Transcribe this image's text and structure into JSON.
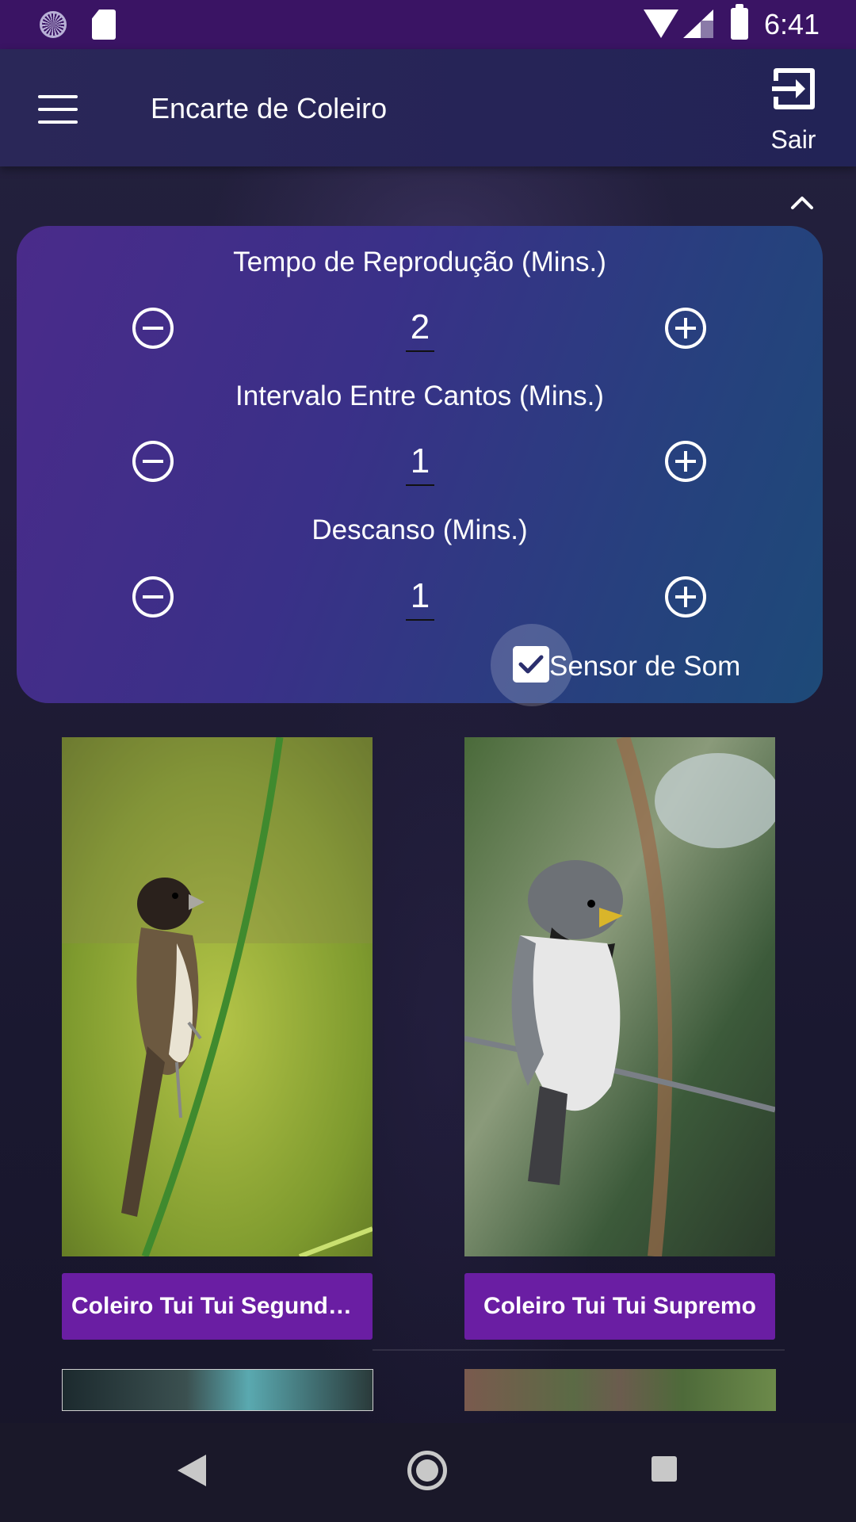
{
  "status_bar": {
    "time": "6:41",
    "icons": [
      "sync-icon",
      "sd-card-icon",
      "wifi-icon",
      "signal-icon",
      "battery-icon"
    ]
  },
  "app_bar": {
    "title": "Encarte de Coleiro",
    "menu_icon": "hamburger-menu-icon",
    "exit_label": "Sair",
    "exit_icon": "exit-icon"
  },
  "panel": {
    "collapse_icon": "chevron-up-icon",
    "settings": [
      {
        "label": "Tempo de Reprodução (Mins.)",
        "value": "2"
      },
      {
        "label": "Intervalo Entre Cantos (Mins.)",
        "value": "1"
      },
      {
        "label": "Descanso (Mins.)",
        "value": "1"
      }
    ],
    "sound_sensor": {
      "label": "Sensor de Som",
      "checked": true
    }
  },
  "cards": [
    {
      "label": "Coleiro Tui Tui Segunda ..."
    },
    {
      "label": "Coleiro Tui Tui Supremo"
    }
  ],
  "colors": {
    "status_bar": "#3a1464",
    "app_bar": "#262457",
    "card_label": "#6a1ea3",
    "panel_start": "#4a2b8a",
    "panel_end": "#1d4a78"
  },
  "nav_bar": {
    "icons": [
      "back-icon",
      "home-icon",
      "recents-icon"
    ]
  }
}
